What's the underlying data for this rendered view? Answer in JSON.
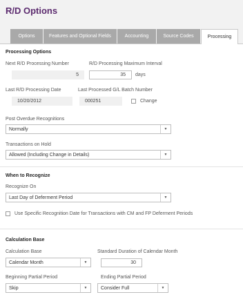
{
  "title": "R/D Options",
  "tabs": [
    "Options",
    "Features and Optional Fields",
    "Accounting",
    "Source Codes",
    "Processing"
  ],
  "processing_options": {
    "heading": "Processing Options",
    "next_number_label": "Next R/D Processing Number",
    "next_number_value": "5",
    "max_interval_label": "R/D Processing Maximum Interval",
    "max_interval_value": "35",
    "days_label": "days",
    "last_date_label": "Last R/D Processing Date",
    "last_date_value": "10/20/2012",
    "last_batch_label": "Last Processed G/L Batch Number",
    "last_batch_value": "000251",
    "change_label": "Change",
    "post_overdue_label": "Post Overdue Recognitions",
    "post_overdue_value": "Normally",
    "on_hold_label": "Transactions on Hold",
    "on_hold_value": "Allowed (Including Change in Details)"
  },
  "when_to_recognize": {
    "heading": "When to Recognize",
    "recognize_on_label": "Recognize On",
    "recognize_on_value": "Last Day of Deferment Period",
    "specific_date_label": "Use Specific Recognition Date for Transactions with CM and FP Deferment Periods"
  },
  "calculation_base": {
    "heading": "Calculation Base",
    "base_label": "Calculation Base",
    "base_value": "Calendar Month",
    "std_duration_label": "Standard Duration of Calendar Month",
    "std_duration_value": "30",
    "begin_partial_label": "Beginning Partial Period",
    "begin_partial_value": "Skip",
    "end_partial_label": "Ending Partial Period",
    "end_partial_value": "Consider Full"
  },
  "icons": {
    "dropdown": "chevron-down-icon",
    "checkbox": "checkbox-icon"
  }
}
